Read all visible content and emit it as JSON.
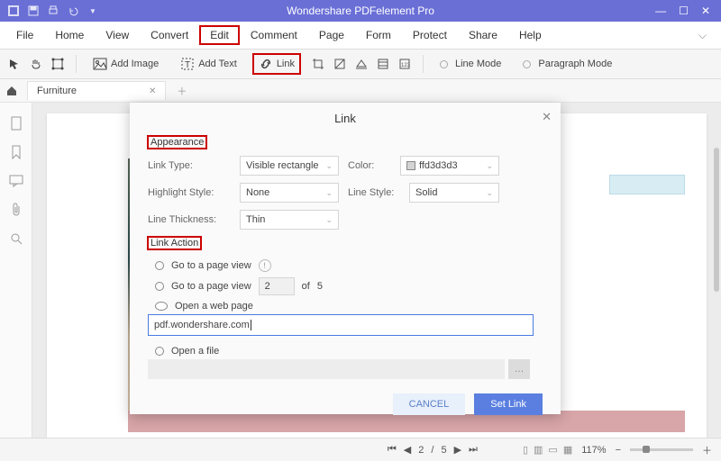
{
  "titlebar": {
    "title": "Wondershare PDFelement Pro"
  },
  "menu": {
    "items": [
      "File",
      "Home",
      "View",
      "Convert",
      "Edit",
      "Comment",
      "Page",
      "Form",
      "Protect",
      "Share",
      "Help"
    ],
    "active": "Edit"
  },
  "toolbar": {
    "add_image": "Add Image",
    "add_text": "Add Text",
    "link": "Link",
    "line_mode": "Line Mode",
    "paragraph_mode": "Paragraph Mode"
  },
  "tab": {
    "name": "Furniture"
  },
  "dialog": {
    "title": "Link",
    "section_appearance": "Appearance",
    "section_action": "Link Action",
    "labels": {
      "link_type": "Link Type:",
      "highlight_style": "Highlight Style:",
      "line_thickness": "Line Thickness:",
      "color": "Color:",
      "line_style": "Line Style:"
    },
    "values": {
      "link_type": "Visible rectangle",
      "highlight_style": "None",
      "line_thickness": "Thin",
      "color": "ffd3d3d3",
      "line_style": "Solid"
    },
    "actions": {
      "goto_view": "Go to a page view",
      "goto_page": "Go to a page view",
      "page_num": "2",
      "of": "of",
      "total": "5",
      "open_web": "Open a web page",
      "url": "pdf.wondershare.com",
      "open_file": "Open a file"
    },
    "buttons": {
      "cancel": "CANCEL",
      "set": "Set Link"
    }
  },
  "status": {
    "page_cur": "2",
    "page_total": "5",
    "zoom": "117%"
  }
}
